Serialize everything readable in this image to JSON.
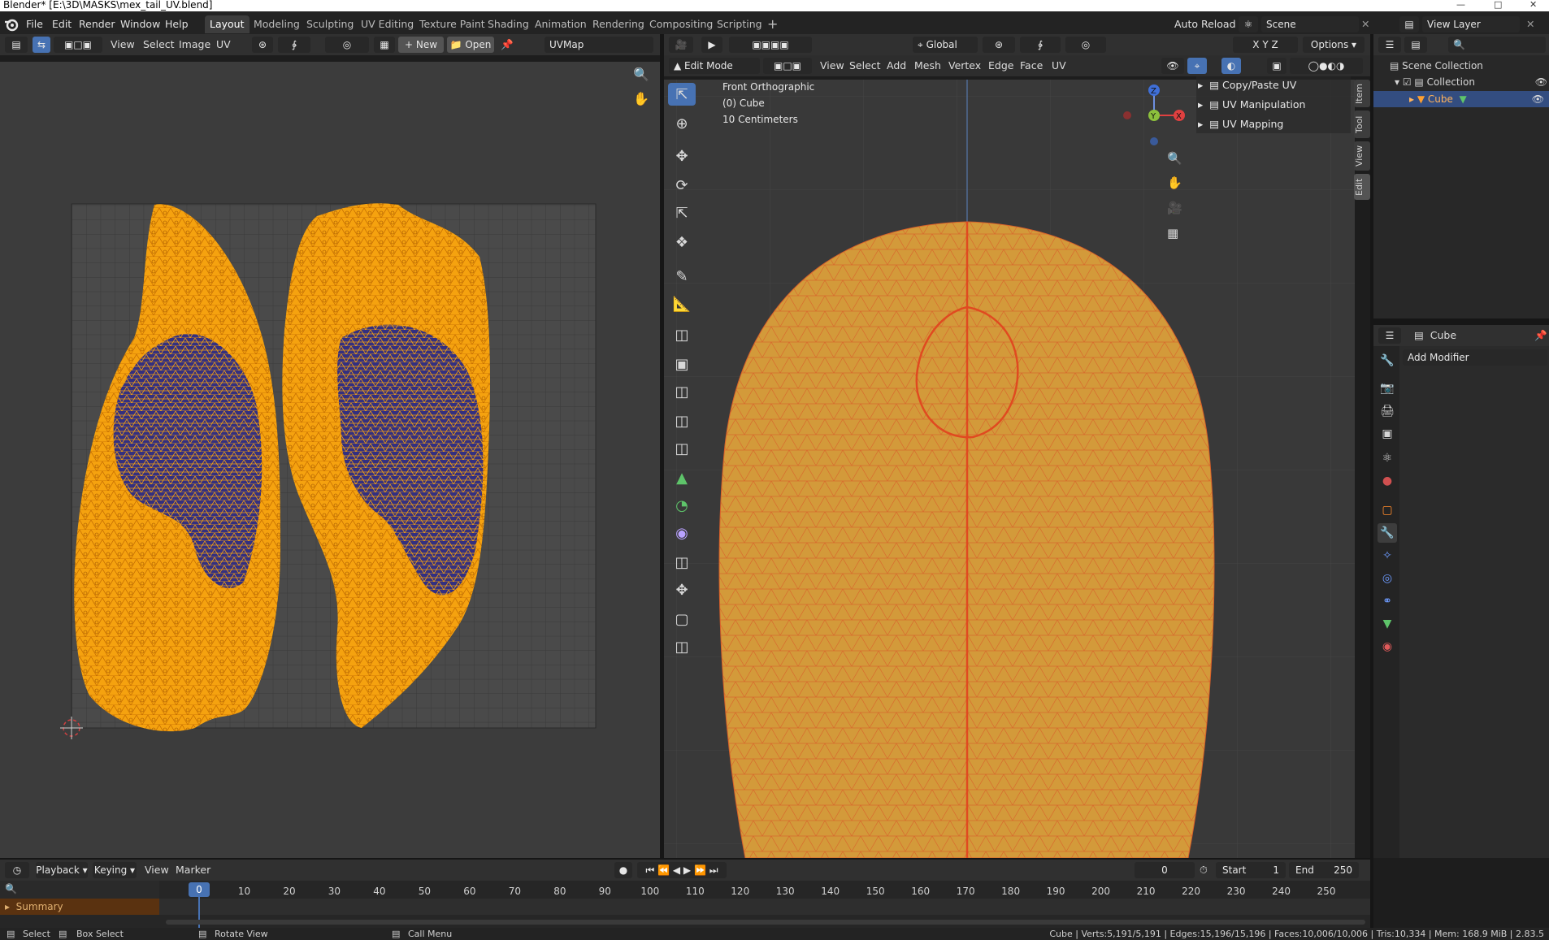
{
  "window_title": "Blender* [E:\\3D\\MASKS\\mex_tail_UV.blend]",
  "main_menu": [
    "File",
    "Edit",
    "Render",
    "Window",
    "Help"
  ],
  "workspaces": [
    {
      "label": "Layout",
      "active": true
    },
    {
      "label": "Modeling"
    },
    {
      "label": "Sculpting"
    },
    {
      "label": "UV Editing"
    },
    {
      "label": "Texture Paint"
    },
    {
      "label": "Shading"
    },
    {
      "label": "Animation"
    },
    {
      "label": "Rendering"
    },
    {
      "label": "Compositing"
    },
    {
      "label": "Scripting"
    }
  ],
  "topbar_right": {
    "auto_reload": "Auto Reload",
    "scene": "Scene",
    "view_layer": "View Layer"
  },
  "uv_header": {
    "menus": [
      "View",
      "Select",
      "Image",
      "UV"
    ],
    "new_label": "New",
    "open_label": "Open",
    "uvmap": "UVMap"
  },
  "viewport_header": {
    "orientation": "Global",
    "options": "Options",
    "mode": "Edit Mode",
    "menus": [
      "View",
      "Select",
      "Add",
      "Mesh",
      "Vertex",
      "Edge",
      "Face",
      "UV"
    ],
    "axes": [
      "X",
      "Y",
      "Z"
    ]
  },
  "viewport_overlay": {
    "view_name": "Front Orthographic",
    "object": "(0) Cube",
    "scale": "10 Centimeters"
  },
  "n_panel": [
    "Copy/Paste UV",
    "UV Manipulation",
    "UV Mapping"
  ],
  "side_tabs": [
    "Item",
    "Tool",
    "View",
    "Edit"
  ],
  "gizmo": {
    "z": "Z",
    "y": "Y",
    "x": "X"
  },
  "outliner": {
    "root": "Scene Collection",
    "collection": "Collection",
    "object": "Cube"
  },
  "properties": {
    "object": "Cube",
    "add_modifier": "Add Modifier"
  },
  "timeline": {
    "menus": [
      "Playback",
      "Keying",
      "View",
      "Marker"
    ],
    "current_frame": "0",
    "start_label": "Start",
    "start": "1",
    "end_label": "End",
    "end": "250",
    "summary": "Summary",
    "ticks": [
      "0",
      "10",
      "20",
      "30",
      "40",
      "50",
      "60",
      "70",
      "80",
      "90",
      "100",
      "110",
      "120",
      "130",
      "140",
      "150",
      "160",
      "170",
      "180",
      "190",
      "200",
      "210",
      "220",
      "230",
      "240",
      "250"
    ]
  },
  "statusbar": {
    "select": "Select",
    "box_select": "Box Select",
    "rotate": "Rotate View",
    "call_menu": "Call Menu",
    "stats": "Cube | Verts:5,191/5,191 | Edges:15,196/15,196 | Faces:10,006/10,006 | Tris:10,334 | Mem: 168.9 MiB | 2.83.5"
  },
  "colors": {
    "accent": "#4772b3",
    "uv_orange": "#f5a20f",
    "uv_blue": "#2a2a86",
    "mesh_fill": "#d39a3a",
    "mesh_wire": "#e0562a"
  }
}
